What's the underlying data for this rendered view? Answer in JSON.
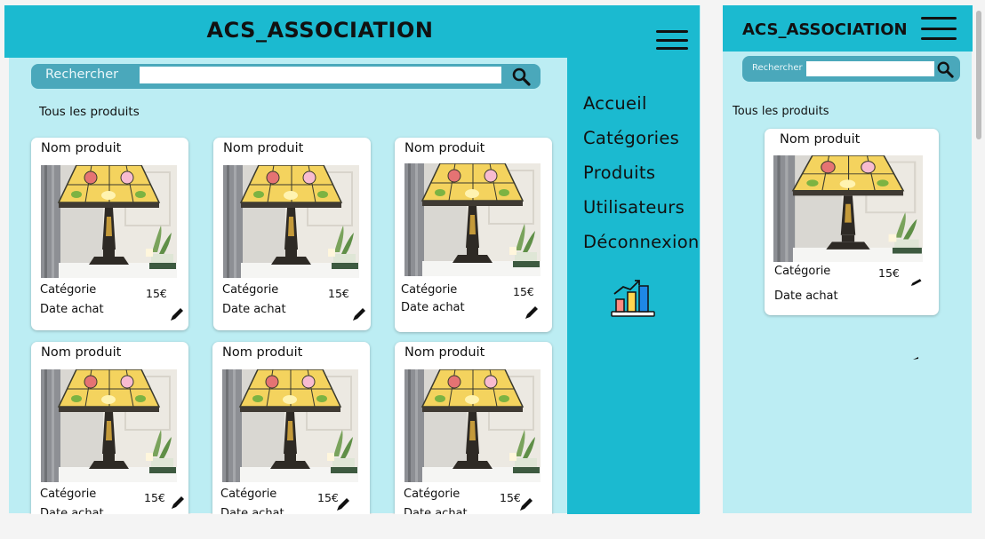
{
  "desktop": {
    "title": "ACS_ASSOCIATION",
    "search": {
      "label": "Rechercher",
      "placeholder": ""
    },
    "section_title": "Tous les produits",
    "menu": [
      {
        "label": "Accueil"
      },
      {
        "label": "Catégories"
      },
      {
        "label": "Produits"
      },
      {
        "label": "Utilisateurs"
      },
      {
        "label": "Déconnexion"
      }
    ],
    "menu_icon": "bar-chart-stats-icon",
    "cards": [
      {
        "name": "Nom produit",
        "category": "Catégorie",
        "price": "15€",
        "date": "Date achat"
      },
      {
        "name": "Nom produit",
        "category": "Catégorie",
        "price": "15€",
        "date": "Date achat"
      },
      {
        "name": "Nom produit",
        "category": "Catégorie",
        "price": "15€",
        "date": "Date achat"
      },
      {
        "name": "Nom produit",
        "category": "Catégorie",
        "price": "15€",
        "date": "Date achat"
      },
      {
        "name": "Nom produit",
        "category": "Catégorie",
        "price": "15€",
        "date": "Date achat"
      },
      {
        "name": "Nom produit",
        "category": "Catégorie",
        "price": "15€",
        "date": "Date achat"
      }
    ]
  },
  "mobile": {
    "title": "ACS_ASSOCIATION",
    "search": {
      "label": "Rechercher",
      "placeholder": ""
    },
    "section_title": "Tous les produits",
    "card": {
      "name": "Nom produit",
      "category": "Catégorie",
      "price": "15€",
      "date": "Date achat"
    }
  },
  "colors": {
    "header": "#1bbad0",
    "background": "#bcedf3",
    "search_bar": "#4aa8bb",
    "card": "#ffffff"
  },
  "icons": {
    "search": "magnifier-icon",
    "menu": "hamburger-icon",
    "edit": "pencil-icon",
    "product_image": "tiffany-lamp-photo"
  }
}
